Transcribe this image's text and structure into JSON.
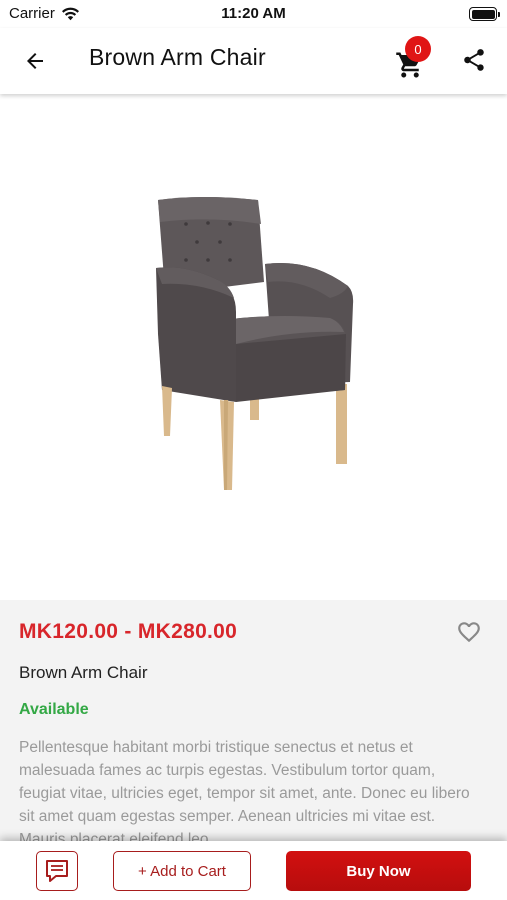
{
  "status_bar": {
    "carrier": "Carrier",
    "time": "11:20 AM",
    "icons": [
      "wifi-icon",
      "battery-icon"
    ]
  },
  "app_bar": {
    "title": "Brown Arm Chair",
    "cart_count": "0",
    "icons": [
      "back-arrow-icon",
      "cart-icon",
      "share-icon"
    ]
  },
  "gallery": {
    "image_subject": "armchair",
    "current_index": 0,
    "total_images": 1
  },
  "product": {
    "price_range": "MK120.00 - MK280.00",
    "name": "Brown Arm Chair",
    "availability": "Available",
    "description": "Pellentesque habitant morbi tristique senectus et netus et malesuada fames ac turpis egestas. Vestibulum tortor quam, feugiat vitae, ultricies eget, tempor sit amet, ante. Donec eu libero sit amet quam egestas semper. Aenean ultricies mi vitae est. Mauris placerat eleifend leo."
  },
  "bottom_bar": {
    "add_to_cart_label": "+ Add to Cart",
    "buy_now_label": "Buy Now",
    "icons": [
      "chat-icon"
    ]
  },
  "colors": {
    "accent_red": "#d8262b",
    "badge_red": "#e01515",
    "button_border": "#a71d1d",
    "available_green": "#33a845",
    "details_bg": "#f3f3f3"
  }
}
